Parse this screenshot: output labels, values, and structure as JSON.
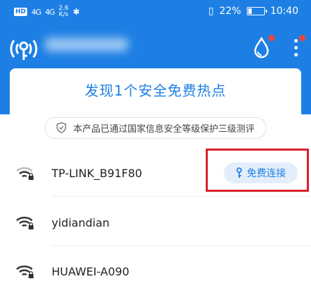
{
  "status_bar": {
    "chip1": "HD",
    "sig1": "4G",
    "sig2": "4G",
    "speed": "2.6",
    "speed_unit": "K/s",
    "battery": "22%",
    "time": "10:40",
    "battery_level": 0.22
  },
  "header": {
    "logo": "wifi-key-logo-icon",
    "drop_icon": "water-drop-icon",
    "more_icon": "more-vertical-icon"
  },
  "banner": {
    "title": "发现1个安全免费热点"
  },
  "notice": {
    "text": "本产品已通过国家信息安全等级保护三级测评"
  },
  "networks": [
    {
      "name": "TP-LINK_B91F80",
      "locked": true,
      "action": "免费连接"
    },
    {
      "name": "yidiandian",
      "locked": true
    },
    {
      "name": "HUAWEI-A090",
      "locked": true
    }
  ],
  "colors": {
    "primary": "#1d7fe4",
    "highlight_box": "#d8202a",
    "badge": "#f04438"
  }
}
